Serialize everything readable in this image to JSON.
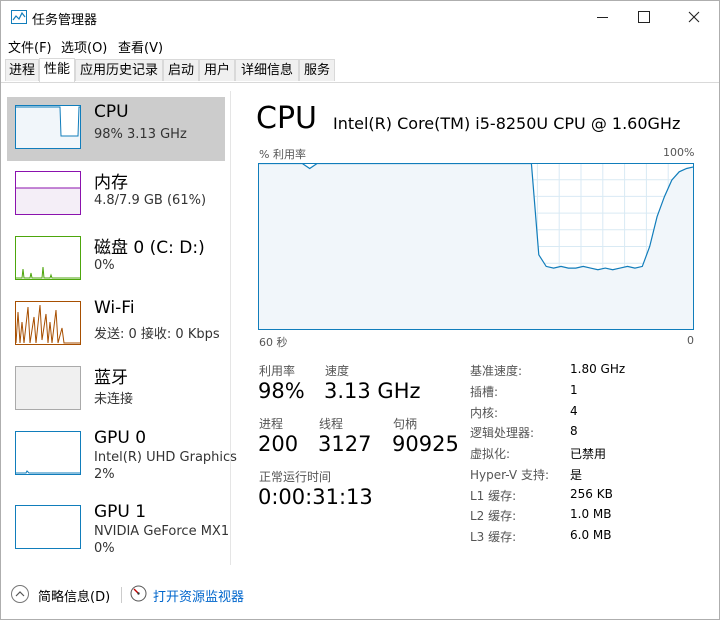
{
  "window": {
    "title": "任务管理器"
  },
  "menu": [
    "文件(F)",
    "选项(O)",
    "查看(V)"
  ],
  "tabs": [
    "进程",
    "性能",
    "应用历史记录",
    "启动",
    "用户",
    "详细信息",
    "服务"
  ],
  "devices": [
    {
      "name": "CPU",
      "detail": "98% 3.13 GHz",
      "color": "#117dbb"
    },
    {
      "name": "内存",
      "detail": "4.8/7.9 GB (61%)",
      "color": "#8b12ae"
    },
    {
      "name": "磁盘 0 (C: D:)",
      "detail": "0%",
      "color": "#4da60c"
    },
    {
      "name": "Wi-Fi",
      "detail": "发送: 0 接收: 0 Kbps",
      "color": "#a74f01"
    },
    {
      "name": "蓝牙",
      "detail": "未连接",
      "color": "#aaaaaa"
    },
    {
      "name": "GPU 0",
      "detail1": "Intel(R) UHD Graphics",
      "detail2": "2%",
      "color": "#117dbb"
    },
    {
      "name": "GPU 1",
      "detail1": "NVIDIA GeForce MX1",
      "detail2": "0%",
      "color": "#117dbb"
    }
  ],
  "cpu": {
    "title": "CPU",
    "model": "Intel(R) Core(TM) i5-8250U CPU @ 1.60GHz",
    "graph": {
      "ylabel": "% 利用率",
      "ymax_label": "100%",
      "xstart_label": "60 秒",
      "xend_label": "0",
      "utilization_percent": [
        100,
        100,
        100,
        100,
        100,
        100,
        100,
        97,
        100,
        100,
        100,
        100,
        100,
        100,
        100,
        100,
        100,
        100,
        100,
        100,
        100,
        100,
        100,
        100,
        100,
        100,
        100,
        100,
        100,
        100,
        100,
        100,
        100,
        100,
        100,
        100,
        100,
        100,
        45,
        38,
        37,
        38,
        37,
        37,
        38,
        37,
        36,
        37,
        36,
        37,
        38,
        37,
        38,
        50,
        68,
        80,
        90,
        95,
        97,
        98
      ]
    },
    "stats": {
      "utilization_label": "利用率",
      "utilization": "98%",
      "speed_label": "速度",
      "speed": "3.13 GHz",
      "processes_label": "进程",
      "processes": "200",
      "threads_label": "线程",
      "threads": "3127",
      "handles_label": "句柄",
      "handles": "90925",
      "uptime_label": "正常运行时间",
      "uptime": "0:00:31:13"
    },
    "specs": [
      {
        "label": "基准速度:",
        "value": "1.80 GHz"
      },
      {
        "label": "插槽:",
        "value": "1"
      },
      {
        "label": "内核:",
        "value": "4"
      },
      {
        "label": "逻辑处理器:",
        "value": "8"
      },
      {
        "label": "虚拟化:",
        "value": "已禁用"
      },
      {
        "label": "Hyper-V 支持:",
        "value": "是"
      },
      {
        "label": "L1 缓存:",
        "value": "256 KB"
      },
      {
        "label": "L2 缓存:",
        "value": "1.0 MB"
      },
      {
        "label": "L3 缓存:",
        "value": "6.0 MB"
      }
    ]
  },
  "footer": {
    "fewer_details": "简略信息(D)",
    "resource_monitor": "打开资源监视器"
  },
  "colors": {
    "cpu_line": "#117dbb",
    "cpu_fill": "#f1f6fa",
    "grid": "#d9eaf4",
    "selected_bg": "#cccccc"
  }
}
